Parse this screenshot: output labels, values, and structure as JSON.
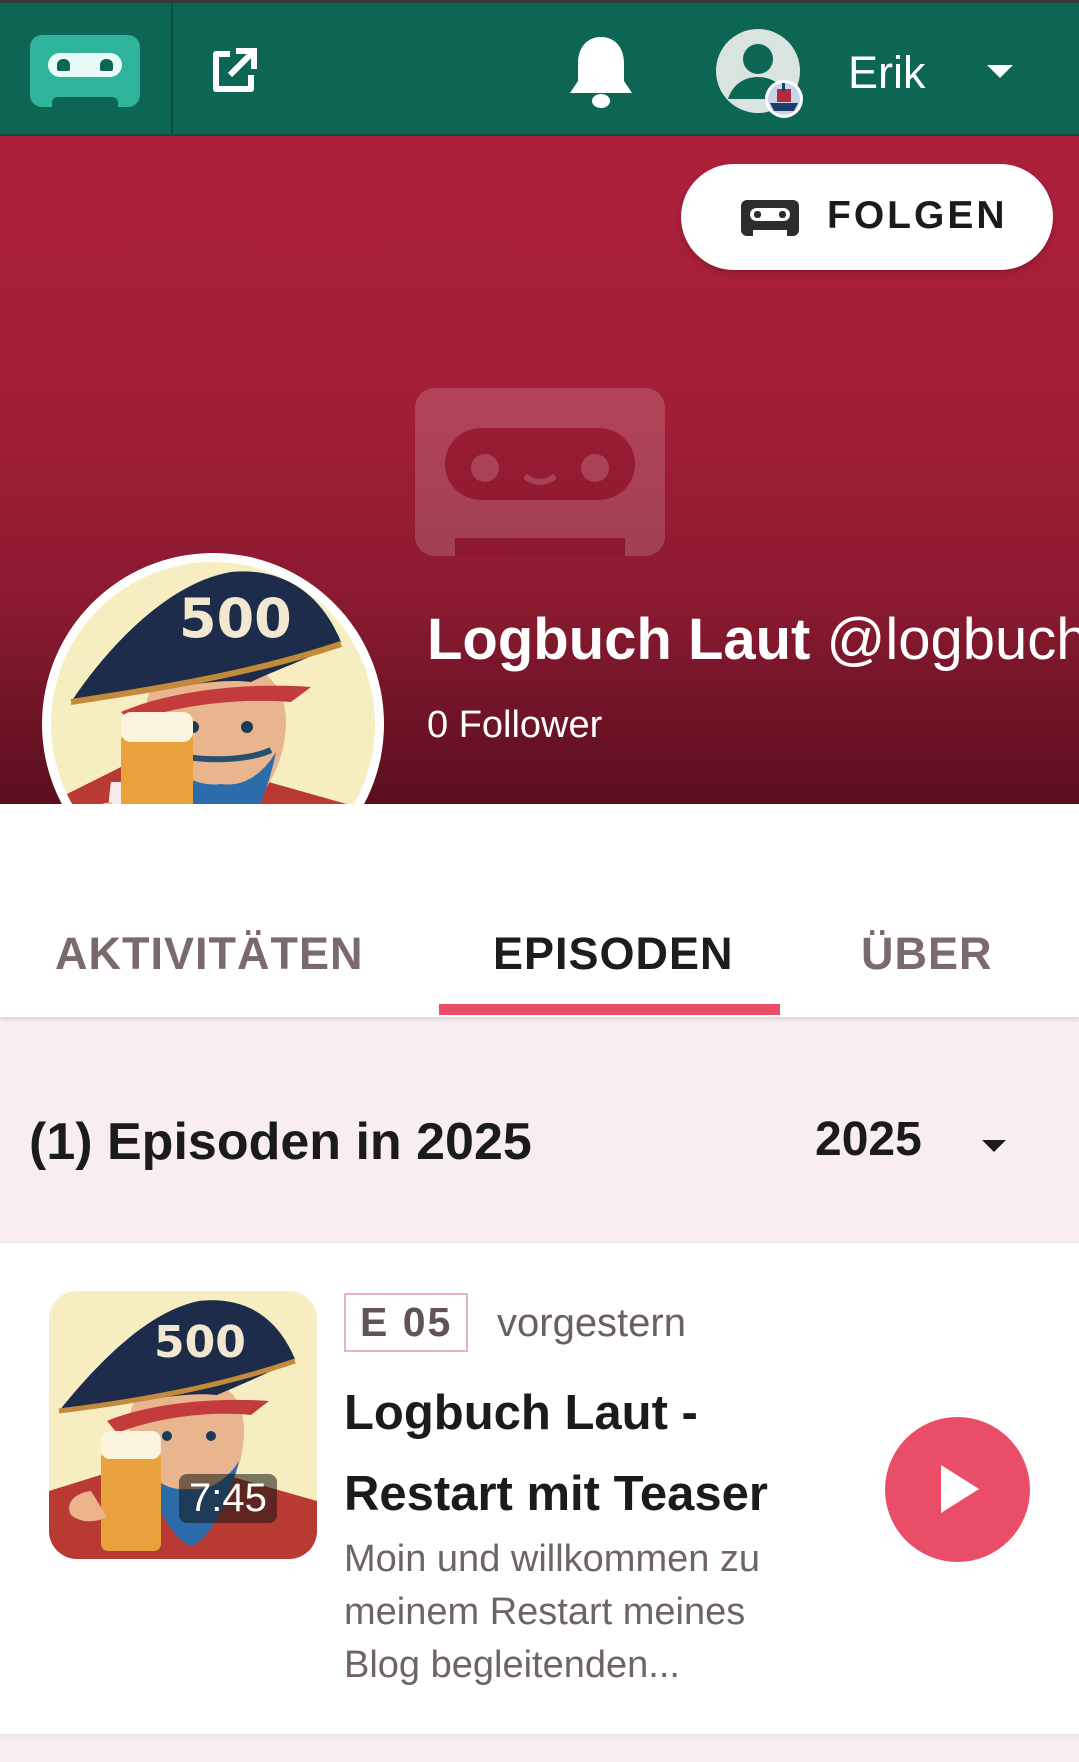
{
  "topbar": {
    "logo_icon": "castopod-logo-icon",
    "share_icon": "external-link-icon",
    "notifications_icon": "bell-icon",
    "user_avatar_icon": "user-avatar-icon",
    "user_name": "Erik",
    "user_menu_icon": "caret-down-icon",
    "background_color": "#0c6653"
  },
  "banner": {
    "follow_button_label": "FOLGEN",
    "follow_icon": "castopod-logo-icon",
    "channel_name": "Logbuch Laut",
    "channel_handle": "@logbuch",
    "followers": "0 Follower",
    "background_color": "#ad203b"
  },
  "tabs": [
    {
      "label": "AKTIVITÄTEN",
      "active": false
    },
    {
      "label": "EPISODEN",
      "active": true
    },
    {
      "label": "ÜBER",
      "active": false
    }
  ],
  "episodes_section": {
    "heading": "(1) Episoden in 2025",
    "year_select_value": "2025"
  },
  "episodes": [
    {
      "number": "E 05",
      "date": "vorgestern",
      "title": "Logbuch Laut - Restart mit Teaser",
      "description": "Moin und willkommen zu meinem Restart meines Blog begleitenden...",
      "duration": "7:45",
      "thumbnail_badge": "500"
    }
  ],
  "avatar": {
    "hat_badge": "500"
  },
  "colors": {
    "accent": "#ea4d67",
    "page_background": "#f8eef0"
  }
}
